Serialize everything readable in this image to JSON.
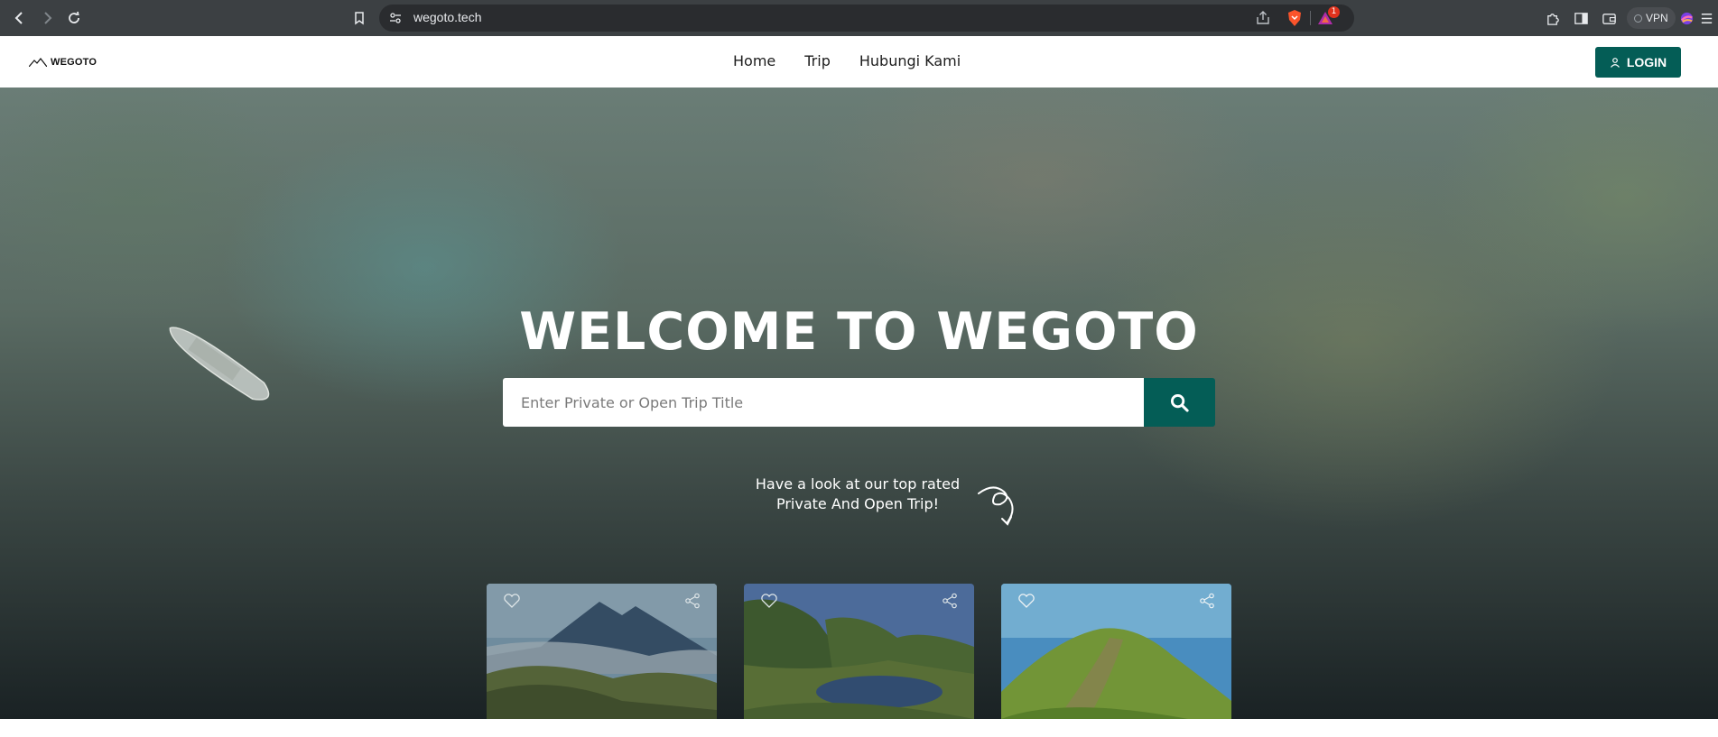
{
  "browser": {
    "url": "wegoto.tech",
    "rewards_count": "1",
    "vpn_label": "VPN",
    "icons": [
      "back-icon",
      "forward-icon",
      "reload-icon",
      "bookmark-icon",
      "site-settings-icon",
      "share-icon",
      "brave-shields-icon",
      "brave-rewards-icon",
      "extensions-icon",
      "sidebar-icon",
      "wallet-icon",
      "profile-icon",
      "menu-icon"
    ]
  },
  "site": {
    "logo_text": "WEGOTO",
    "nav": [
      "Home",
      "Trip",
      "Hubungi Kami"
    ],
    "login_label": "LOGIN",
    "brand_color": "#045d56"
  },
  "hero": {
    "title": "WELCOME TO WEGOTO",
    "search_placeholder": "Enter Private or Open Trip Title",
    "tagline_line1": "Have a look at our top rated",
    "tagline_line2": "Private And Open Trip!"
  },
  "cards": [
    {
      "image": "volcano-mountain-landscape"
    },
    {
      "image": "mountain-lake-landscape"
    },
    {
      "image": "green-hill-trail-landscape"
    }
  ]
}
